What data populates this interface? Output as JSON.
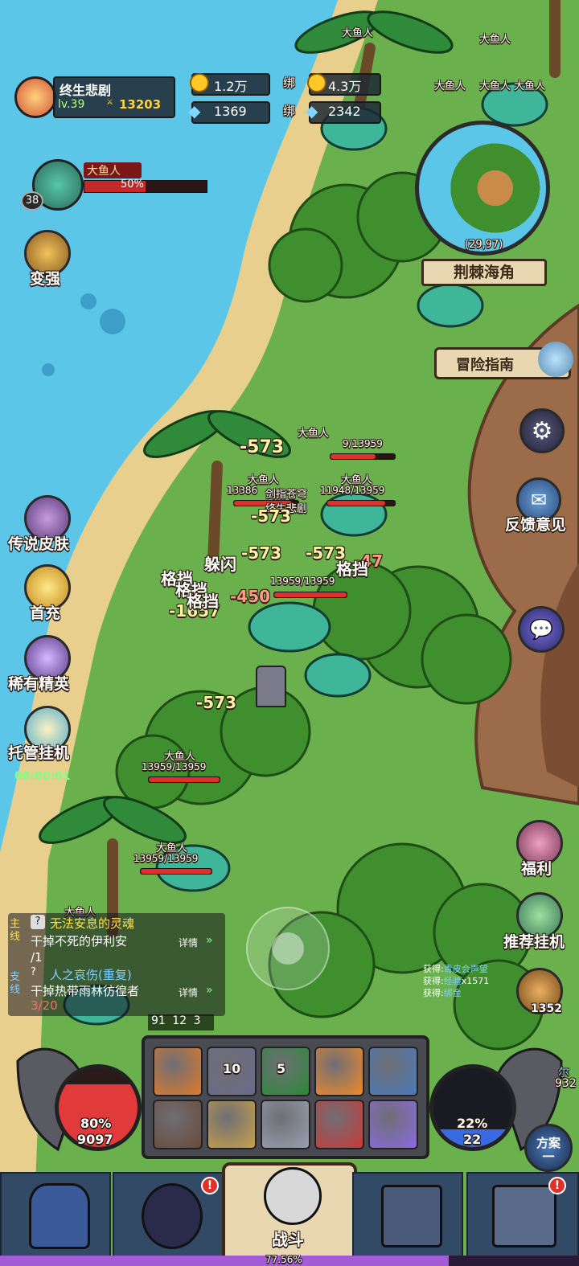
{
  "player": {
    "name": "终生悲剧",
    "level": "lv.39",
    "power": "13203",
    "gold": "1.2万",
    "bound_label_1": "绑",
    "bound_gold": "4.3万",
    "diamond": "1369",
    "bound_label_2": "绑",
    "bound_diamond": "2342"
  },
  "target": {
    "name": "大鱼人",
    "hp_percent_text": "50%",
    "hp_fraction": 0.5,
    "level": "38"
  },
  "minimap": {
    "coords": "(29,97)",
    "location": "荆棘海角"
  },
  "left_menu": {
    "strengthen": "变强",
    "legend_skin": "传说皮肤",
    "first_recharge": "首充",
    "rare_elite": "稀有精英",
    "auto_idle": "托管挂机",
    "idle_timer": "00:00:01"
  },
  "right_menu": {
    "guide": "冒险指南",
    "feedback": "反馈意见",
    "welfare": "福利",
    "recommend_idle": "推荐挂机",
    "bread_count": "1352"
  },
  "enemies": [
    {
      "name": "大鱼人"
    },
    {
      "name": "大鱼人"
    },
    {
      "name": "大鱼人"
    },
    {
      "name": "大鱼人 大鱼人"
    },
    {
      "name": "大鱼人",
      "hp": "9/13959"
    },
    {
      "name": "大鱼人",
      "hp": "13386"
    },
    {
      "name": "大鱼人",
      "hp": "11948/13959"
    },
    {
      "name": "大鱼人",
      "hp": "13959/13959"
    },
    {
      "name": "大鱼人",
      "hp": "13959/13959"
    },
    {
      "name": "大鱼人",
      "hp": "13959/13959"
    },
    {
      "name": "大鱼人"
    }
  ],
  "labels": {
    "guild_title": "剑指苍穹",
    "player_overhead": "终生悲剧"
  },
  "combat_text": {
    "dmg_a": "-573",
    "dmg_b": "-573",
    "dmg_c": "-573",
    "dmg_d": "-573",
    "dmg_e": "-47",
    "dmg_f": "-450",
    "dmg_g": "-1657",
    "dmg_h": "-573",
    "dodge": "躲闪",
    "block_1": "格挡",
    "block_2": "格挡",
    "block_3": "格挡",
    "block_4": "格挡"
  },
  "quests": [
    {
      "tag": "主线",
      "title": "无法安息的灵魂",
      "desc": "干掉不死的伊利安",
      "progress": "/1",
      "detail": "详情"
    },
    {
      "tag": "支线",
      "title": "人之哀伤(重复)",
      "desc": "干掉热带雨林彷徨者",
      "progress": "3/20",
      "detail": "详情"
    }
  ],
  "loot_log": [
    {
      "prefix": "获得:",
      "item": "青皮会声望"
    },
    {
      "prefix": "获得:",
      "item": "经验",
      "count": "x1571"
    },
    {
      "prefix": "获得:",
      "item": "绑金"
    }
  ],
  "buff_counts": [
    "91",
    "12",
    "3"
  ],
  "skills": [
    {
      "name": "shadow-orb",
      "count": ""
    },
    {
      "name": "armor-strike",
      "count": "10"
    },
    {
      "name": "poison-spirit",
      "count": "5"
    },
    {
      "name": "flame-burst",
      "count": ""
    },
    {
      "name": "barrel-shield",
      "count": ""
    },
    {
      "name": "dark-helmet",
      "count": ""
    },
    {
      "name": "golden-shield",
      "count": ""
    },
    {
      "name": "blade-slash",
      "count": ""
    },
    {
      "name": "red-claw",
      "count": ""
    },
    {
      "name": "light-sword",
      "count": ""
    }
  ],
  "hp_orb": {
    "percent": "80%",
    "value": "9097",
    "fill": 0.8
  },
  "mp_orb": {
    "percent": "22%",
    "value": "22",
    "fill": 0.22
  },
  "plan_button": {
    "label": "方案",
    "num": "一"
  },
  "side_right_text": {
    "a": "尔",
    "b": "932"
  },
  "bottom_nav": [
    {
      "name": "tab-rock"
    },
    {
      "name": "tab-hero"
    },
    {
      "name": "tab-battle",
      "label": "战斗"
    },
    {
      "name": "tab-base"
    },
    {
      "name": "tab-fortress"
    }
  ],
  "exp_bar": {
    "text": "77.56%",
    "fill": 0.7756
  },
  "colors": {
    "sea": "#5cc6e8",
    "sand": "#e8cf8e",
    "grass": "#6ab04c",
    "cliff": "#9b6b4a",
    "hp_red": "#e0302a",
    "exp_purple": "#a35bd6",
    "quest_yellow": "#ffe14d",
    "quest_blue": "#7fd0ff"
  }
}
